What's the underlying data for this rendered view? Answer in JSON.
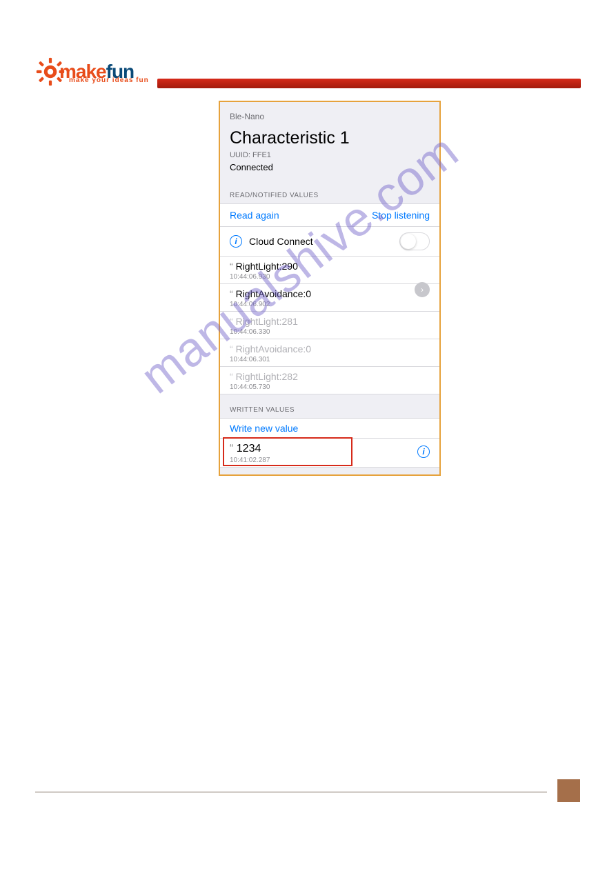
{
  "logo": {
    "make": "make",
    "fun": "fun",
    "tagline": "make your ideas fun"
  },
  "watermark": "manualshive.com",
  "phone": {
    "device": "Ble-Nano",
    "title": "Characteristic 1",
    "uuid_label": "UUID: FFE1",
    "status": "Connected",
    "sections": {
      "read": "READ/NOTIFIED VALUES",
      "written": "WRITTEN VALUES"
    },
    "actions": {
      "read_again": "Read again",
      "stop_listening": "Stop listening",
      "cloud_connect": "Cloud Connect",
      "write_new": "Write new value"
    },
    "read_values": [
      {
        "text": "RightLight:290",
        "ts": "10:44:06.930",
        "dim": false
      },
      {
        "text": "RightAvoidance:0",
        "ts": "10:44:06.902",
        "dim": false
      },
      {
        "text": "RightLight:281",
        "ts": "10:44:06.330",
        "dim": true
      },
      {
        "text": "RightAvoidance:0",
        "ts": "10:44:06.301",
        "dim": true
      },
      {
        "text": "RightLight:282",
        "ts": "10:44:05.730",
        "dim": true
      }
    ],
    "written_values": [
      {
        "text": "1234",
        "ts": "10:41:02.287"
      }
    ]
  }
}
